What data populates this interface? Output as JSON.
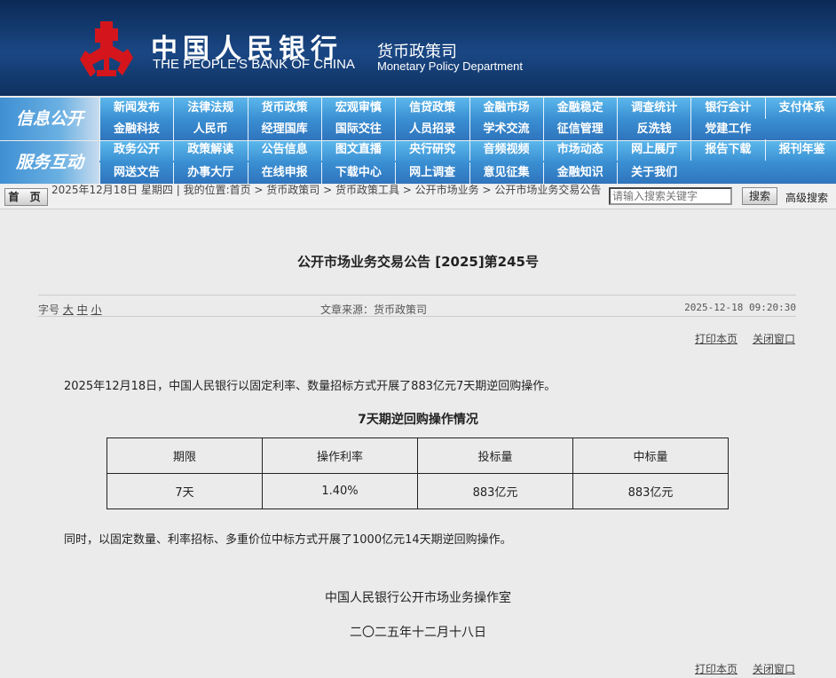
{
  "header": {
    "bank_cn": "中国人民银行",
    "bank_en": "THE PEOPLE'S BANK OF CHINA",
    "dept_cn": "货币政策司",
    "dept_en": "Monetary Policy Department"
  },
  "nav": {
    "band1_label": "信息公开",
    "band1_row1": [
      "新闻发布",
      "法律法规",
      "货币政策",
      "宏观审慎",
      "信贷政策",
      "金融市场",
      "金融稳定",
      "调查统计",
      "银行会计",
      "支付体系"
    ],
    "band1_row2": [
      "金融科技",
      "人民币",
      "经理国库",
      "国际交往",
      "人员招录",
      "学术交流",
      "征信管理",
      "反洗钱",
      "党建工作"
    ],
    "band2_label": "服务互动",
    "band2_row1": [
      "政务公开",
      "政策解读",
      "公告信息",
      "图文直播",
      "央行研究",
      "音频视频",
      "市场动态",
      "网上展厅",
      "报告下载",
      "报刊年鉴"
    ],
    "band2_row2": [
      "网送文告",
      "办事大厅",
      "在线申报",
      "下载中心",
      "网上调查",
      "意见征集",
      "金融知识",
      "关于我们"
    ]
  },
  "crumb": {
    "home": "首 页",
    "text": "2025年12月18日 星期四 | 我的位置:首页 > 货币政策司 > 货币政策工具 > 公开市场业务 > 公开市场业务交易公告",
    "search_placeholder": "请输入搜索关键字",
    "search_btn": "搜索",
    "advanced": "高级搜索"
  },
  "article": {
    "title": "公开市场业务交易公告 [2025]第245号",
    "font_label": "字号",
    "font_large": "大",
    "font_mid": "中",
    "font_small": "小",
    "source": "文章来源：货币政策司",
    "datetime": "2025-12-18 09:20:30",
    "print": "打印本页",
    "close": "关闭窗口",
    "para1": "2025年12月18日，中国人民银行以固定利率、数量招标方式开展了883亿元7天期逆回购操作。",
    "table_title": "7天期逆回购操作情况",
    "table_headers": [
      "期限",
      "操作利率",
      "投标量",
      "中标量"
    ],
    "table_row": [
      "7天",
      "1.40%",
      "883亿元",
      "883亿元"
    ],
    "para2": "同时，以固定数量、利率招标、多重价位中标方式开展了1000亿元14天期逆回购操作。",
    "signature": "中国人民银行公开市场业务操作室",
    "date_cn": "二〇二五年十二月十八日"
  }
}
